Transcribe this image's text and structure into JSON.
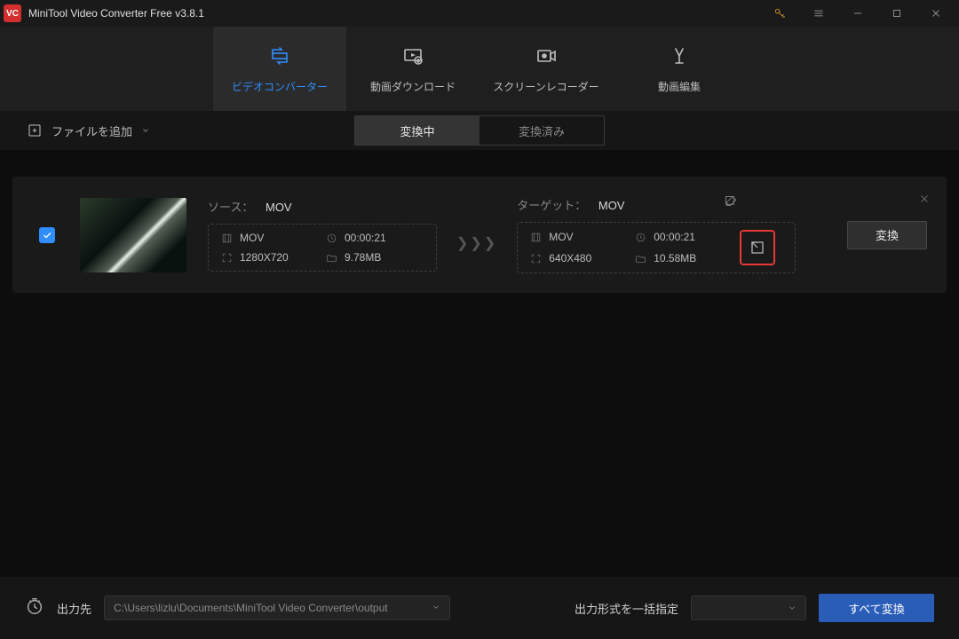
{
  "window": {
    "title": "MiniTool Video Converter Free v3.8.1"
  },
  "nav": {
    "converter": "ビデオコンバーター",
    "download": "動画ダウンロード",
    "recorder": "スクリーンレコーダー",
    "edit": "動画編集"
  },
  "toolbar": {
    "add_file": "ファイルを追加",
    "tab_converting": "変換中",
    "tab_converted": "変換済み"
  },
  "item": {
    "source_label": "ソース：",
    "source_format": "MOV",
    "target_label": "ターゲット：",
    "target_format": "MOV",
    "src": {
      "container": "MOV",
      "duration": "00:00:21",
      "resolution": "1280X720",
      "size": "9.78MB"
    },
    "tgt": {
      "container": "MOV",
      "duration": "00:00:21",
      "resolution": "640X480",
      "size": "10.58MB"
    },
    "arrows": "❯❯❯",
    "convert_btn": "変換"
  },
  "bottom": {
    "output_label": "出力先",
    "output_path": "C:\\Users\\lizlu\\Documents\\MiniTool Video Converter\\output",
    "format_label": "出力形式を一括指定",
    "convert_all": "すべて変換"
  }
}
